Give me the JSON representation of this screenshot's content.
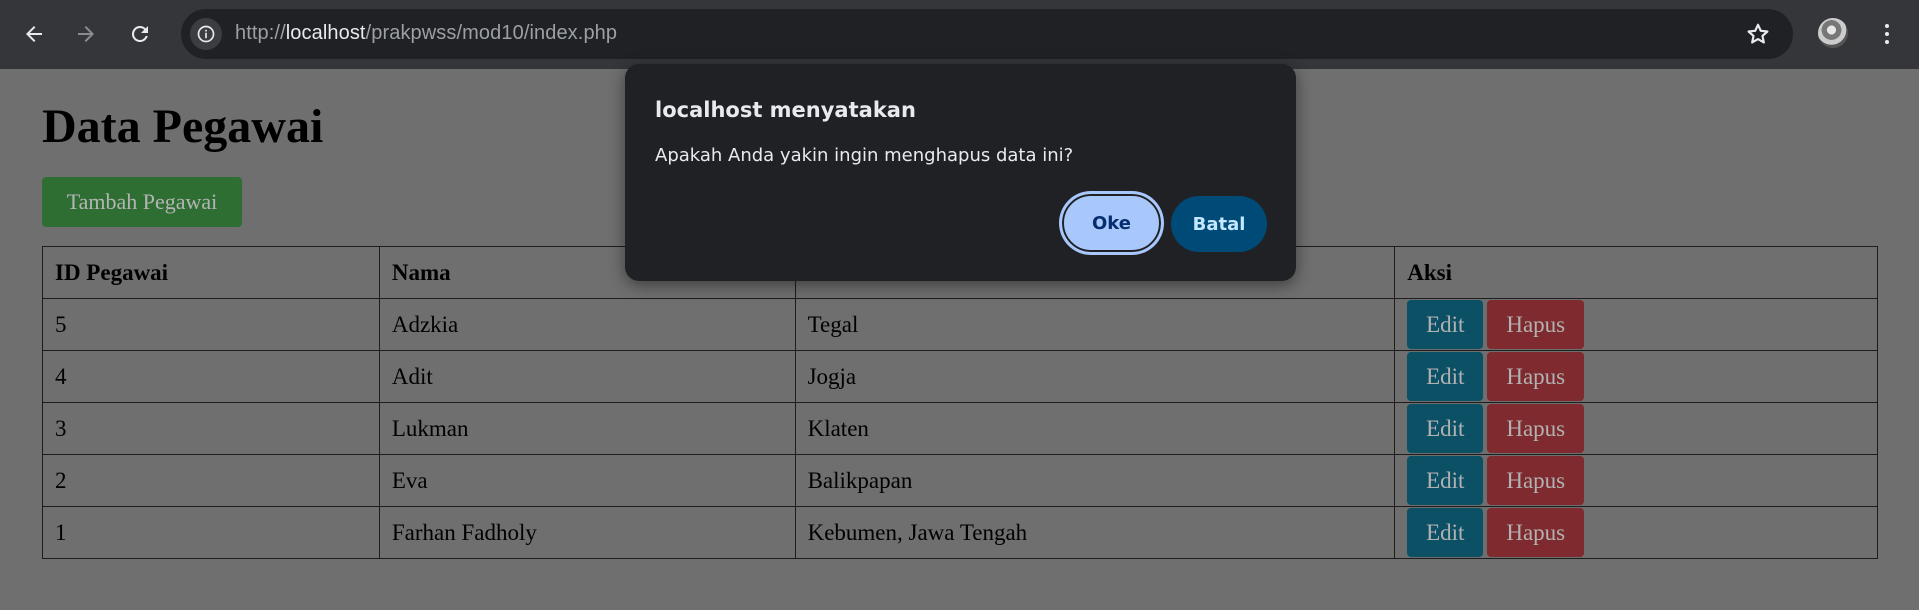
{
  "browser": {
    "url_prefix": "http://",
    "url_host": "localhost",
    "url_path": "/prakpwss/mod10/index.php",
    "icons": {
      "back": "arrow-left-icon",
      "forward": "arrow-right-icon",
      "reload": "reload-icon",
      "site_info": "info-icon",
      "bookmark": "star-icon",
      "profile": "avatar",
      "menu": "kebab-menu-icon"
    }
  },
  "page": {
    "title": "Data Pegawai",
    "add_button": "Tambah Pegawai",
    "table": {
      "headers": [
        "ID Pegawai",
        "Nama",
        "",
        "Aksi"
      ],
      "rows": [
        {
          "id": "5",
          "nama": "Adzkia",
          "alamat": "Tegal",
          "edit": "Edit",
          "hapus": "Hapus"
        },
        {
          "id": "4",
          "nama": "Adit",
          "alamat": "Jogja",
          "edit": "Edit",
          "hapus": "Hapus"
        },
        {
          "id": "3",
          "nama": "Lukman",
          "alamat": "Klaten",
          "edit": "Edit",
          "hapus": "Hapus"
        },
        {
          "id": "2",
          "nama": "Eva",
          "alamat": "Balikpapan",
          "edit": "Edit",
          "hapus": "Hapus"
        },
        {
          "id": "1",
          "nama": "Farhan Fadholy",
          "alamat": "Kebumen, Jawa Tengah",
          "edit": "Edit",
          "hapus": "Hapus"
        }
      ]
    }
  },
  "dialog": {
    "title": "localhost menyatakan",
    "message": "Apakah Anda yakin ingin menghapus data ini?",
    "ok_label": "Oke",
    "cancel_label": "Batal"
  },
  "colors": {
    "chrome_toolbar": "#35363a",
    "omnibox": "#202124",
    "page_overlay_bg": "#6f6f6f",
    "add_button": "#2e6e33",
    "edit_button": "#0c5066",
    "delete_button": "#7e2a2e",
    "dialog_bg": "#202124",
    "ok_button": "#a8c7fa",
    "cancel_button": "#004a77"
  }
}
